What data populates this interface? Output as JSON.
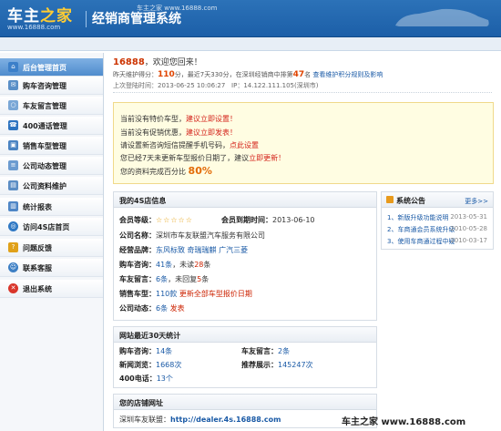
{
  "header": {
    "logo_main": "车主",
    "logo_accent": "之家",
    "logo_url": "www.16888.com",
    "title": "经销商管理系统",
    "watermark": "车主之家 www.16888.com"
  },
  "sidebar": {
    "items": [
      {
        "label": "后台管理首页",
        "icon": "home-icon",
        "color": "#3b7fc9"
      },
      {
        "label": "购车咨询管理",
        "icon": "chat-icon",
        "color": "#5a8fc7"
      },
      {
        "label": "车友留言管理",
        "icon": "message-icon",
        "color": "#7aa7d6"
      },
      {
        "label": "400通话管理",
        "icon": "phone-icon",
        "color": "#2e74c0"
      },
      {
        "label": "销售车型管理",
        "icon": "car-icon",
        "color": "#4a83c2"
      },
      {
        "label": "公司动态管理",
        "icon": "news-icon",
        "color": "#6b9bd0"
      },
      {
        "label": "公司资料维护",
        "icon": "document-icon",
        "color": "#5b8dc4"
      },
      {
        "label": "统计报表",
        "icon": "report-icon",
        "color": "#4f86c6"
      },
      {
        "label": "访问4S店首页",
        "icon": "globe-icon",
        "color": "#2f78c4"
      },
      {
        "label": "问题反馈",
        "icon": "help-icon",
        "color": "#e0a11a"
      },
      {
        "label": "联系客服",
        "icon": "headset-icon",
        "color": "#3d7fc4"
      },
      {
        "label": "退出系统",
        "icon": "exit-icon",
        "color": "#d9362b"
      }
    ]
  },
  "welcome": {
    "uid": "16888",
    "greeting": "，欢迎您回来！",
    "line2_a": "昨天维护得分：",
    "score_yesterday": "110",
    "line2_b": "分，最近7天330分，在深圳经销商中排第",
    "rank": "47",
    "line2_c": "名",
    "rules_link": "查看维护积分规则及影响",
    "last_login_label": "上次登陆时间：",
    "last_login_time": "2013-06-25 10:06:27",
    "ip_label": "IP：",
    "ip": "14.122.111.105(深圳市)"
  },
  "notice": {
    "l1_text": "当前没有特价车型，",
    "l1_link": "建议立即设置！",
    "l2_text": "当前没有促销优惠，",
    "l2_link": "建议立即发表！",
    "l3_text": "请设置新咨询短信提醒手机号码，",
    "l3_link": "点此设置",
    "l4_text": "您已经7天未更新车型报价日期了，建议",
    "l4_link": "立即更新！",
    "l5_text": "您的资料完成百分比",
    "l5_pct": "80%"
  },
  "shop_info": {
    "title": "我的4S店信息",
    "member_level_label": "会员等级：",
    "stars": "☆☆☆☆☆",
    "expiry_label": "会员到期时间：",
    "expiry": "2013-06-10",
    "company_label": "公司名称：",
    "company": "深圳市车友联盟汽车服务有限公司",
    "brands_label": "经营品牌：",
    "brands": "东风标致  奇瑞瑞麒  广汽三菱",
    "inquiry_label": "购车咨询：",
    "inquiry_total": "41条",
    "inquiry_unread_label": "，未读",
    "inquiry_unread": "28",
    "inquiry_unit": "条",
    "comments_label": "车友留言：",
    "comments_total": "6条",
    "comments_unreplied_label": "，未回复",
    "comments_unreplied": "5",
    "comments_unit": "条",
    "models_label": "销售车型：",
    "models_count": "110款",
    "models_update_link": "更新全部车型报价日期",
    "news_label": "公司动态：",
    "news_count": "6条",
    "news_post_link": "发表"
  },
  "announcements": {
    "title": "系统公告",
    "more": "更多>>",
    "items": [
      {
        "text": "1、新版升级功能说明",
        "date": "2013-05-31"
      },
      {
        "text": "2、车商通会员系统升级",
        "date": "2010-05-28"
      },
      {
        "text": "3、使用车商通过程中疑",
        "date": "2010-03-17"
      }
    ]
  },
  "stats": {
    "title": "网站最近30天统计",
    "inquiry_label": "购车咨询：",
    "inquiry": "14条",
    "comments_label": "车友留言：",
    "comments": "2条",
    "views_label": "新闻浏览：",
    "views": "1668次",
    "promo_label": "推荐展示：",
    "promo": "145247次",
    "calls_label": "400电话：",
    "calls": "13个"
  },
  "shop_url": {
    "title": "您的店铺网址",
    "label": "深圳车友联盟：",
    "url": "http://dealer.4s.16888.com"
  },
  "watermark_bottom": "车主之家 www.16888.com"
}
